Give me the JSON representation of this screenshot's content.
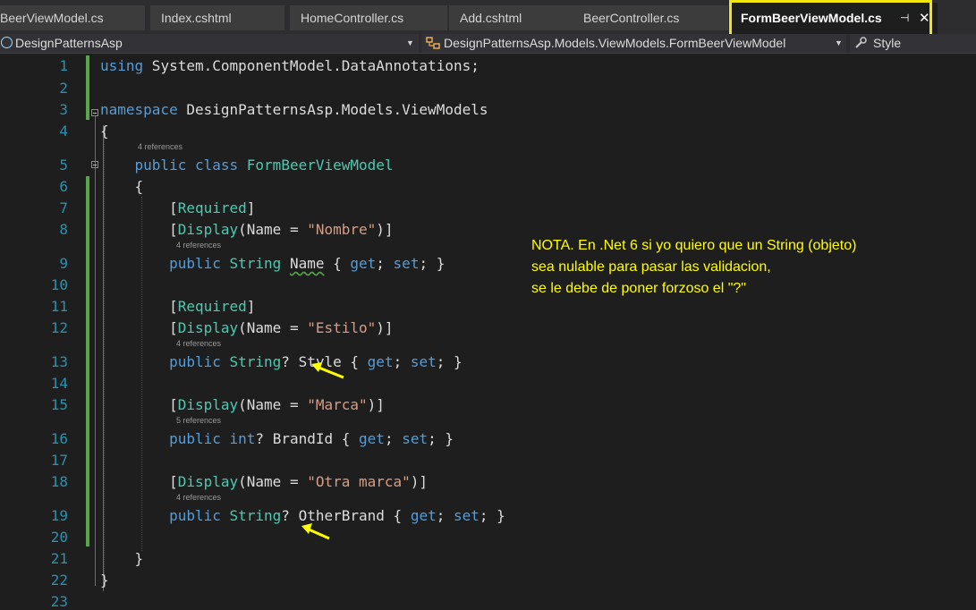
{
  "tabs": [
    {
      "label": "BeerViewModel.cs"
    },
    {
      "label": "Index.cshtml"
    },
    {
      "label": "HomeController.cs"
    },
    {
      "label": "Add.cshtml"
    },
    {
      "label": "BeerController.cs"
    },
    {
      "label": "FormBeerViewModel.cs",
      "active": true,
      "pin_glyph": "⊣",
      "close_glyph": "✕"
    }
  ],
  "navbar": {
    "project": "DesignPatternsAsp",
    "type": "DesignPatternsAsp.Models.ViewModels.FormBeerViewModel",
    "member": "Style"
  },
  "line_numbers": [
    "1",
    "2",
    "3",
    "4",
    "5",
    "6",
    "7",
    "8",
    "9",
    "10",
    "11",
    "12",
    "13",
    "14",
    "15",
    "16",
    "17",
    "18",
    "19",
    "20",
    "21",
    "22",
    "23"
  ],
  "code": {
    "l1_kw": "using",
    "l1_rest": " System.ComponentModel.DataAnnotations;",
    "l3_kw": "namespace",
    "l3_rest": " DesignPatternsAsp.Models.ViewModels",
    "open_brace": "{",
    "close_brace": "}",
    "public": "public",
    "class": "class",
    "class_name": "FormBeerViewModel",
    "required_attr": "Required",
    "display_attr": "Display",
    "name_eq": "(Name = ",
    "close_attr": ")]",
    "open_attr": "[",
    "close_sq": "]",
    "str_nombre": "\"Nombre\"",
    "str_estilo": "\"Estilo\"",
    "str_marca": "\"Marca\"",
    "str_otra": "\"Otra marca\"",
    "type_string": "String",
    "type_int": "int",
    "nullable_mark": "?",
    "prop_name": "Name",
    "prop_style": "Style",
    "prop_brand": "BrandId",
    "prop_other": "OtherBrand",
    "accessors_open": " { ",
    "get": "get",
    "set": "set",
    "semi_space": "; ",
    "accessors_close": "; }"
  },
  "references": {
    "class_refs": "4 references",
    "name_refs": "4 references",
    "style_refs": "4 references",
    "brand_refs": "5 references",
    "other_refs": "4 references"
  },
  "note": {
    "line1": "NOTA. En .Net 6 si yo quiero que un String (objeto)",
    "line2": "sea nulable para pasar las validacion,",
    "line3": "se le debe de poner forzoso el \"?\""
  },
  "colors": {
    "highlight": "#f1e60e",
    "note_text": "#ffff00",
    "keyword": "#569cd6",
    "type": "#4ec9b0",
    "string": "#d69d85",
    "line_number": "#2b91af",
    "change_bar": "#57a64a"
  }
}
